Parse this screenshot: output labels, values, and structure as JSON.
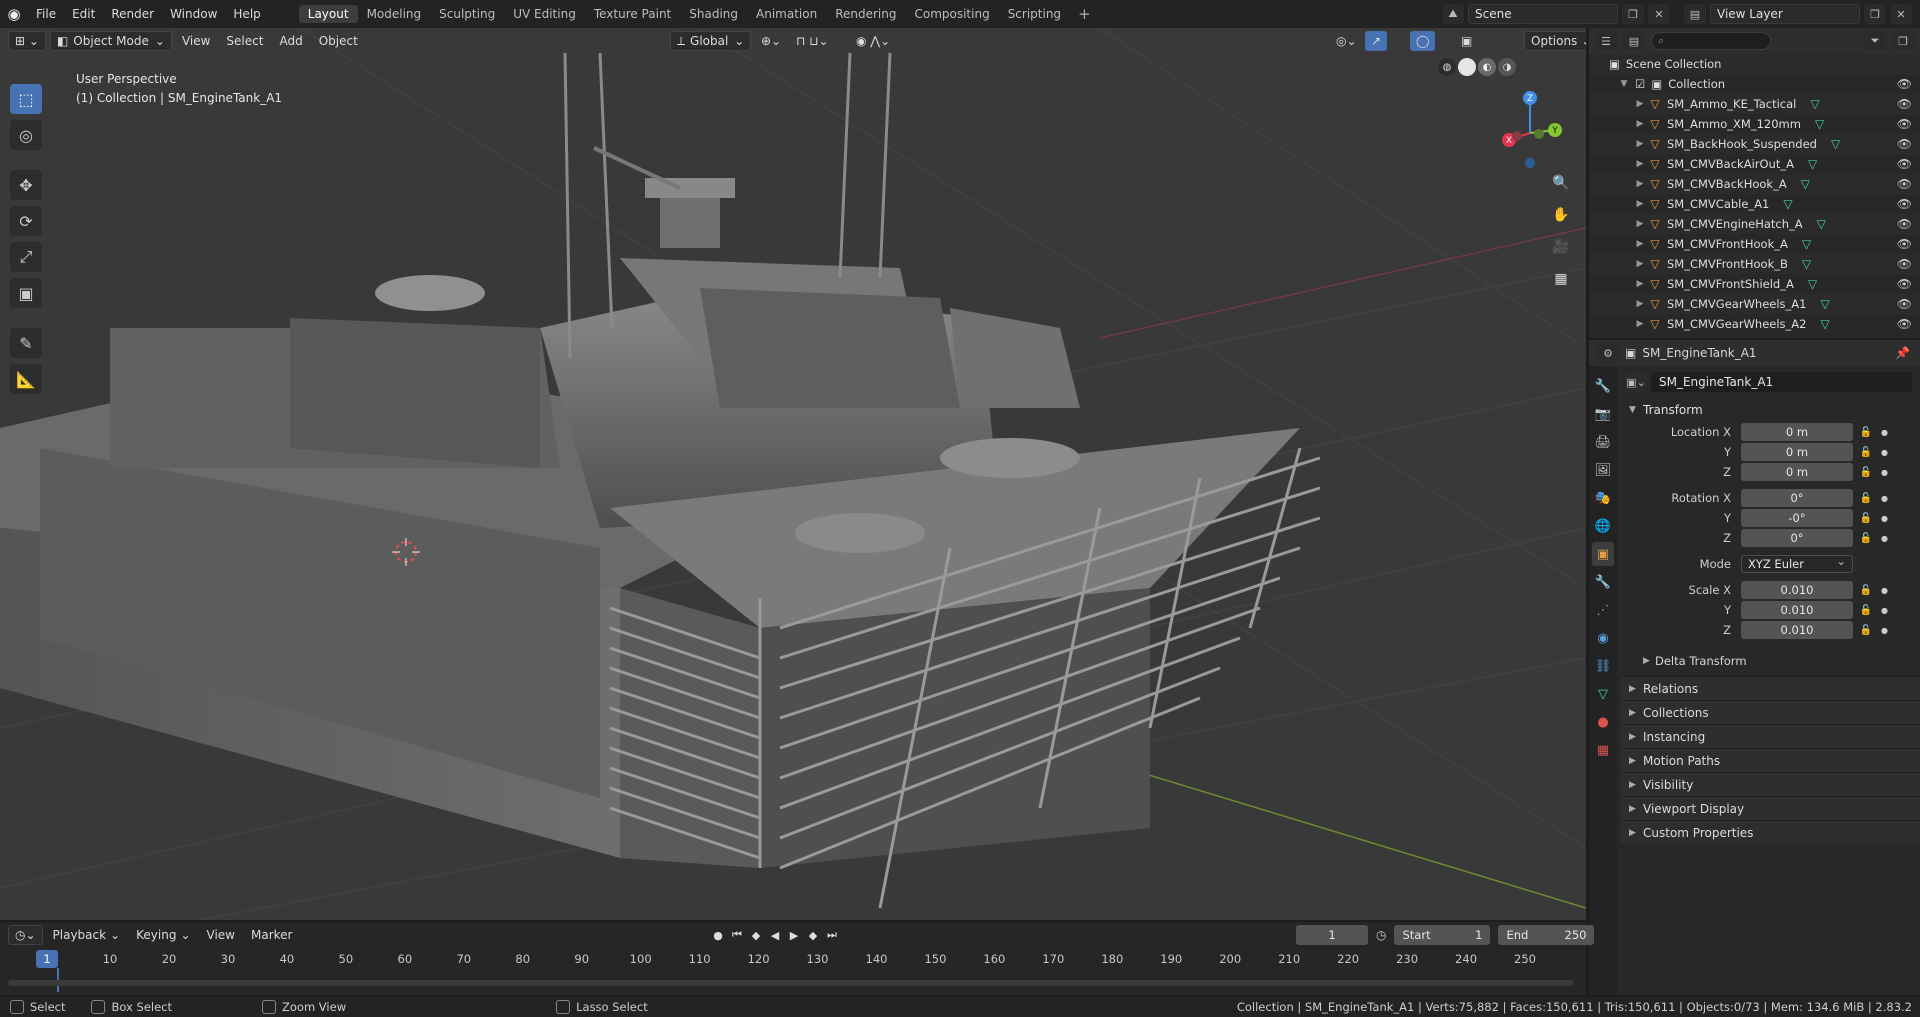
{
  "topbar": {
    "menus": [
      "File",
      "Edit",
      "Render",
      "Window",
      "Help"
    ],
    "workspaces": [
      "Layout",
      "Modeling",
      "Sculpting",
      "UV Editing",
      "Texture Paint",
      "Shading",
      "Animation",
      "Rendering",
      "Compositing",
      "Scripting"
    ],
    "active_workspace": "Layout",
    "scene": "Scene",
    "view_layer": "View Layer"
  },
  "viewport": {
    "mode": "Object Mode",
    "menus": [
      "View",
      "Select",
      "Add",
      "Object"
    ],
    "orientation": "Global",
    "options_label": "Options",
    "perspective": "User Perspective",
    "collection_info": "(1) Collection | SM_EngineTank_A1",
    "gizmo": {
      "x": "X",
      "y": "Y",
      "z": "Z"
    }
  },
  "outliner": {
    "root": "Scene Collection",
    "collection": "Collection",
    "items": [
      "SM_Ammo_KE_Tactical",
      "SM_Ammo_XM_120mm",
      "SM_BackHook_Suspended",
      "SM_CMVBackAirOut_A",
      "SM_CMVBackHook_A",
      "SM_CMVCable_A1",
      "SM_CMVEngineHatch_A",
      "SM_CMVFrontHook_A",
      "SM_CMVFrontHook_B",
      "SM_CMVFrontShield_A",
      "SM_CMVGearWheels_A1",
      "SM_CMVGearWheels_A2"
    ]
  },
  "properties": {
    "object_name": "SM_EngineTank_A1",
    "transform_title": "Transform",
    "location": {
      "label_x": "Location X",
      "label_y": "Y",
      "label_z": "Z",
      "x": "0 m",
      "y": "0 m",
      "z": "0 m"
    },
    "rotation": {
      "label_x": "Rotation X",
      "label_y": "Y",
      "label_z": "Z",
      "x": "0°",
      "y": "-0°",
      "z": "0°"
    },
    "mode": {
      "label": "Mode",
      "value": "XYZ Euler"
    },
    "scale": {
      "label_x": "Scale X",
      "label_y": "Y",
      "label_z": "Z",
      "x": "0.010",
      "y": "0.010",
      "z": "0.010"
    },
    "delta_transform": "Delta Transform",
    "panels": [
      "Relations",
      "Collections",
      "Instancing",
      "Motion Paths",
      "Visibility",
      "Viewport Display",
      "Custom Properties"
    ]
  },
  "timeline": {
    "menus": [
      "Playback",
      "Keying",
      "View",
      "Marker"
    ],
    "current_frame": "1",
    "start_label": "Start",
    "start": "1",
    "end_label": "End",
    "end": "250",
    "ticks": [
      "10",
      "20",
      "30",
      "40",
      "50",
      "60",
      "70",
      "80",
      "90",
      "100",
      "110",
      "120",
      "130",
      "140",
      "150",
      "160",
      "170",
      "180",
      "190",
      "200",
      "210",
      "220",
      "230",
      "240",
      "250"
    ],
    "playhead_label": "1"
  },
  "statusbar": {
    "select": "Select",
    "box_select": "Box Select",
    "zoom_view": "Zoom View",
    "lasso_select": "Lasso Select",
    "stats": "Collection | SM_EngineTank_A1 | Verts:75,882 | Faces:150,611 | Tris:150,611 | Objects:0/73 | Mem: 134.6 MiB | 2.83.2"
  },
  "colors": {
    "accent": "#4772b3",
    "object_icon": "#e39a45",
    "mesh_icon": "#3fd1a0",
    "axis_x": "#e5334d",
    "axis_y": "#83c830",
    "axis_z": "#3f8fe8"
  }
}
